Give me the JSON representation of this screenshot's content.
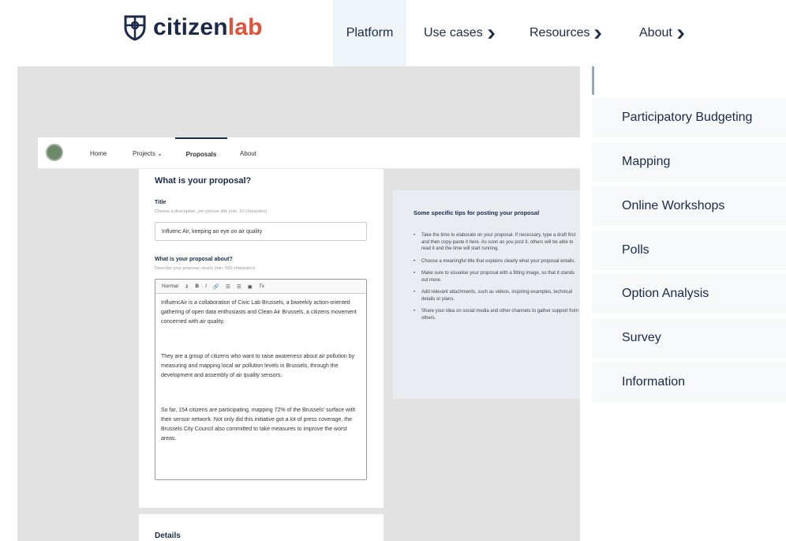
{
  "brand": {
    "name_part1": "citizen",
    "name_part2": "lab"
  },
  "nav": {
    "items": [
      {
        "label": "Platform",
        "active": true
      },
      {
        "label": "Use cases",
        "active": false
      },
      {
        "label": "Resources",
        "active": false
      },
      {
        "label": "About",
        "active": false
      }
    ]
  },
  "side_menu": {
    "items": [
      "Participatory Budgeting",
      "Mapping",
      "Online Workshops",
      "Polls",
      "Option Analysis",
      "Survey",
      "Information"
    ]
  },
  "app_nav": {
    "items": [
      "Home",
      "Projects ⌄",
      "Proposals",
      "About"
    ]
  },
  "form": {
    "heading": "What is your proposal?",
    "title_label": "Title",
    "title_hint": "Choose a descriptive, yet concise title (min. 10 characters)",
    "title_value": "Influenc Air, keeping an eye on air quality",
    "about_label": "What is your proposal about?",
    "about_hint": "Describe your proposal clearly (min. 500 characters)",
    "toolbar": {
      "format": "Normal",
      "bold": "B",
      "italic": "I",
      "link": "🔗",
      "ol": "☰",
      "ul": "☰",
      "image": "▣",
      "clear": "Tx"
    },
    "body_paragraphs": [
      "InfluencAir is a collaboration of Civic Lab Brussels, a biweekly action-oriented gathering of open data enthusiasts and Clean Air Brussels, a citizens movement concerned with air quality.",
      "They are a group of citizens who want to raise awareness about air pollution by measuring and mapping local air pollution levels in Brussels, through the development and assembly of air quality sensors.",
      "So far, 154 citizens are participating, mapping 72% of the Brussels' surface with their sensor network. Not only did this initiative got a lot of press coverage, the Brussels City Council also committed to take measures to improve the worst areas."
    ],
    "details_heading": "Details"
  },
  "tips": {
    "title": "Some specific tips for posting your proposal",
    "items": [
      "Take the time to elaborate on your proposal. If necessary, type a draft first and then copy-paste it here. As soon as you post it, others will be able to read it and the time will start running.",
      "Choose a meaningful title that explains clearly what your proposal entails.",
      "Make sure to visualise your proposal with a fitting image, so that it stands out more.",
      "Add relevant attachments, such as videos, inspiring examples, technical details or plans.",
      "Share your idea on social media and other channels to gather support from others."
    ]
  },
  "colors": {
    "brand_dark": "#1b2a4a",
    "brand_accent": "#e0523a",
    "nav_active_bg": "#eef4f8"
  }
}
